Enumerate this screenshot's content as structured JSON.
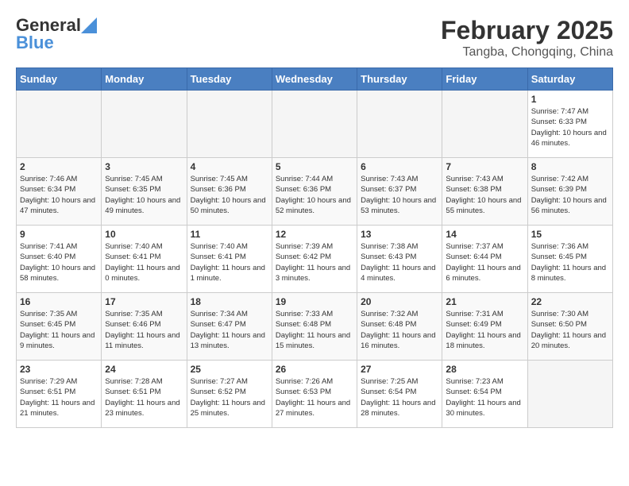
{
  "header": {
    "logo_text_general": "General",
    "logo_text_blue": "Blue",
    "month_year": "February 2025",
    "location": "Tangba, Chongqing, China"
  },
  "days_of_week": [
    "Sunday",
    "Monday",
    "Tuesday",
    "Wednesday",
    "Thursday",
    "Friday",
    "Saturday"
  ],
  "weeks": [
    [
      {
        "day": "",
        "empty": true
      },
      {
        "day": "",
        "empty": true
      },
      {
        "day": "",
        "empty": true
      },
      {
        "day": "",
        "empty": true
      },
      {
        "day": "",
        "empty": true
      },
      {
        "day": "",
        "empty": true
      },
      {
        "day": "1",
        "sunrise": "7:47 AM",
        "sunset": "6:33 PM",
        "daylight": "10 hours and 46 minutes."
      }
    ],
    [
      {
        "day": "2",
        "sunrise": "7:46 AM",
        "sunset": "6:34 PM",
        "daylight": "10 hours and 47 minutes."
      },
      {
        "day": "3",
        "sunrise": "7:45 AM",
        "sunset": "6:35 PM",
        "daylight": "10 hours and 49 minutes."
      },
      {
        "day": "4",
        "sunrise": "7:45 AM",
        "sunset": "6:36 PM",
        "daylight": "10 hours and 50 minutes."
      },
      {
        "day": "5",
        "sunrise": "7:44 AM",
        "sunset": "6:36 PM",
        "daylight": "10 hours and 52 minutes."
      },
      {
        "day": "6",
        "sunrise": "7:43 AM",
        "sunset": "6:37 PM",
        "daylight": "10 hours and 53 minutes."
      },
      {
        "day": "7",
        "sunrise": "7:43 AM",
        "sunset": "6:38 PM",
        "daylight": "10 hours and 55 minutes."
      },
      {
        "day": "8",
        "sunrise": "7:42 AM",
        "sunset": "6:39 PM",
        "daylight": "10 hours and 56 minutes."
      }
    ],
    [
      {
        "day": "9",
        "sunrise": "7:41 AM",
        "sunset": "6:40 PM",
        "daylight": "10 hours and 58 minutes."
      },
      {
        "day": "10",
        "sunrise": "7:40 AM",
        "sunset": "6:41 PM",
        "daylight": "11 hours and 0 minutes."
      },
      {
        "day": "11",
        "sunrise": "7:40 AM",
        "sunset": "6:41 PM",
        "daylight": "11 hours and 1 minute."
      },
      {
        "day": "12",
        "sunrise": "7:39 AM",
        "sunset": "6:42 PM",
        "daylight": "11 hours and 3 minutes."
      },
      {
        "day": "13",
        "sunrise": "7:38 AM",
        "sunset": "6:43 PM",
        "daylight": "11 hours and 4 minutes."
      },
      {
        "day": "14",
        "sunrise": "7:37 AM",
        "sunset": "6:44 PM",
        "daylight": "11 hours and 6 minutes."
      },
      {
        "day": "15",
        "sunrise": "7:36 AM",
        "sunset": "6:45 PM",
        "daylight": "11 hours and 8 minutes."
      }
    ],
    [
      {
        "day": "16",
        "sunrise": "7:35 AM",
        "sunset": "6:45 PM",
        "daylight": "11 hours and 9 minutes."
      },
      {
        "day": "17",
        "sunrise": "7:35 AM",
        "sunset": "6:46 PM",
        "daylight": "11 hours and 11 minutes."
      },
      {
        "day": "18",
        "sunrise": "7:34 AM",
        "sunset": "6:47 PM",
        "daylight": "11 hours and 13 minutes."
      },
      {
        "day": "19",
        "sunrise": "7:33 AM",
        "sunset": "6:48 PM",
        "daylight": "11 hours and 15 minutes."
      },
      {
        "day": "20",
        "sunrise": "7:32 AM",
        "sunset": "6:48 PM",
        "daylight": "11 hours and 16 minutes."
      },
      {
        "day": "21",
        "sunrise": "7:31 AM",
        "sunset": "6:49 PM",
        "daylight": "11 hours and 18 minutes."
      },
      {
        "day": "22",
        "sunrise": "7:30 AM",
        "sunset": "6:50 PM",
        "daylight": "11 hours and 20 minutes."
      }
    ],
    [
      {
        "day": "23",
        "sunrise": "7:29 AM",
        "sunset": "6:51 PM",
        "daylight": "11 hours and 21 minutes."
      },
      {
        "day": "24",
        "sunrise": "7:28 AM",
        "sunset": "6:51 PM",
        "daylight": "11 hours and 23 minutes."
      },
      {
        "day": "25",
        "sunrise": "7:27 AM",
        "sunset": "6:52 PM",
        "daylight": "11 hours and 25 minutes."
      },
      {
        "day": "26",
        "sunrise": "7:26 AM",
        "sunset": "6:53 PM",
        "daylight": "11 hours and 27 minutes."
      },
      {
        "day": "27",
        "sunrise": "7:25 AM",
        "sunset": "6:54 PM",
        "daylight": "11 hours and 28 minutes."
      },
      {
        "day": "28",
        "sunrise": "7:23 AM",
        "sunset": "6:54 PM",
        "daylight": "11 hours and 30 minutes."
      },
      {
        "day": "",
        "empty": true
      }
    ]
  ]
}
